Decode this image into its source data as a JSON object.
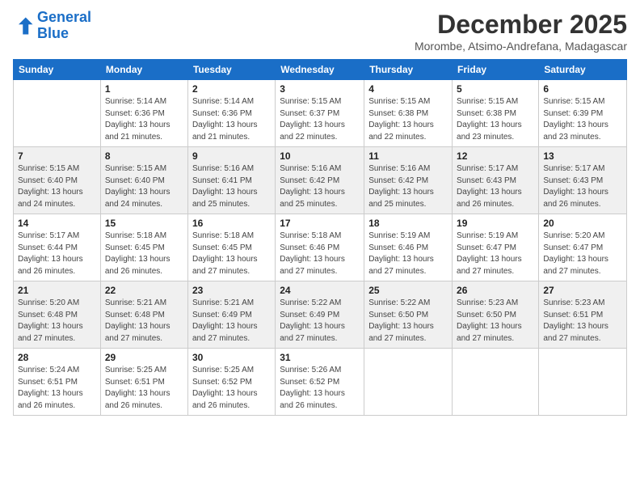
{
  "logo": {
    "line1": "General",
    "line2": "Blue"
  },
  "title": "December 2025",
  "location": "Morombe, Atsimo-Andrefana, Madagascar",
  "days_header": [
    "Sunday",
    "Monday",
    "Tuesday",
    "Wednesday",
    "Thursday",
    "Friday",
    "Saturday"
  ],
  "weeks": [
    [
      {
        "day": "",
        "info": ""
      },
      {
        "day": "1",
        "info": "Sunrise: 5:14 AM\nSunset: 6:36 PM\nDaylight: 13 hours\nand 21 minutes."
      },
      {
        "day": "2",
        "info": "Sunrise: 5:14 AM\nSunset: 6:36 PM\nDaylight: 13 hours\nand 21 minutes."
      },
      {
        "day": "3",
        "info": "Sunrise: 5:15 AM\nSunset: 6:37 PM\nDaylight: 13 hours\nand 22 minutes."
      },
      {
        "day": "4",
        "info": "Sunrise: 5:15 AM\nSunset: 6:38 PM\nDaylight: 13 hours\nand 22 minutes."
      },
      {
        "day": "5",
        "info": "Sunrise: 5:15 AM\nSunset: 6:38 PM\nDaylight: 13 hours\nand 23 minutes."
      },
      {
        "day": "6",
        "info": "Sunrise: 5:15 AM\nSunset: 6:39 PM\nDaylight: 13 hours\nand 23 minutes."
      }
    ],
    [
      {
        "day": "7",
        "info": "Sunrise: 5:15 AM\nSunset: 6:40 PM\nDaylight: 13 hours\nand 24 minutes."
      },
      {
        "day": "8",
        "info": "Sunrise: 5:15 AM\nSunset: 6:40 PM\nDaylight: 13 hours\nand 24 minutes."
      },
      {
        "day": "9",
        "info": "Sunrise: 5:16 AM\nSunset: 6:41 PM\nDaylight: 13 hours\nand 25 minutes."
      },
      {
        "day": "10",
        "info": "Sunrise: 5:16 AM\nSunset: 6:42 PM\nDaylight: 13 hours\nand 25 minutes."
      },
      {
        "day": "11",
        "info": "Sunrise: 5:16 AM\nSunset: 6:42 PM\nDaylight: 13 hours\nand 25 minutes."
      },
      {
        "day": "12",
        "info": "Sunrise: 5:17 AM\nSunset: 6:43 PM\nDaylight: 13 hours\nand 26 minutes."
      },
      {
        "day": "13",
        "info": "Sunrise: 5:17 AM\nSunset: 6:43 PM\nDaylight: 13 hours\nand 26 minutes."
      }
    ],
    [
      {
        "day": "14",
        "info": "Sunrise: 5:17 AM\nSunset: 6:44 PM\nDaylight: 13 hours\nand 26 minutes."
      },
      {
        "day": "15",
        "info": "Sunrise: 5:18 AM\nSunset: 6:45 PM\nDaylight: 13 hours\nand 26 minutes."
      },
      {
        "day": "16",
        "info": "Sunrise: 5:18 AM\nSunset: 6:45 PM\nDaylight: 13 hours\nand 27 minutes."
      },
      {
        "day": "17",
        "info": "Sunrise: 5:18 AM\nSunset: 6:46 PM\nDaylight: 13 hours\nand 27 minutes."
      },
      {
        "day": "18",
        "info": "Sunrise: 5:19 AM\nSunset: 6:46 PM\nDaylight: 13 hours\nand 27 minutes."
      },
      {
        "day": "19",
        "info": "Sunrise: 5:19 AM\nSunset: 6:47 PM\nDaylight: 13 hours\nand 27 minutes."
      },
      {
        "day": "20",
        "info": "Sunrise: 5:20 AM\nSunset: 6:47 PM\nDaylight: 13 hours\nand 27 minutes."
      }
    ],
    [
      {
        "day": "21",
        "info": "Sunrise: 5:20 AM\nSunset: 6:48 PM\nDaylight: 13 hours\nand 27 minutes."
      },
      {
        "day": "22",
        "info": "Sunrise: 5:21 AM\nSunset: 6:48 PM\nDaylight: 13 hours\nand 27 minutes."
      },
      {
        "day": "23",
        "info": "Sunrise: 5:21 AM\nSunset: 6:49 PM\nDaylight: 13 hours\nand 27 minutes."
      },
      {
        "day": "24",
        "info": "Sunrise: 5:22 AM\nSunset: 6:49 PM\nDaylight: 13 hours\nand 27 minutes."
      },
      {
        "day": "25",
        "info": "Sunrise: 5:22 AM\nSunset: 6:50 PM\nDaylight: 13 hours\nand 27 minutes."
      },
      {
        "day": "26",
        "info": "Sunrise: 5:23 AM\nSunset: 6:50 PM\nDaylight: 13 hours\nand 27 minutes."
      },
      {
        "day": "27",
        "info": "Sunrise: 5:23 AM\nSunset: 6:51 PM\nDaylight: 13 hours\nand 27 minutes."
      }
    ],
    [
      {
        "day": "28",
        "info": "Sunrise: 5:24 AM\nSunset: 6:51 PM\nDaylight: 13 hours\nand 26 minutes."
      },
      {
        "day": "29",
        "info": "Sunrise: 5:25 AM\nSunset: 6:51 PM\nDaylight: 13 hours\nand 26 minutes."
      },
      {
        "day": "30",
        "info": "Sunrise: 5:25 AM\nSunset: 6:52 PM\nDaylight: 13 hours\nand 26 minutes."
      },
      {
        "day": "31",
        "info": "Sunrise: 5:26 AM\nSunset: 6:52 PM\nDaylight: 13 hours\nand 26 minutes."
      },
      {
        "day": "",
        "info": ""
      },
      {
        "day": "",
        "info": ""
      },
      {
        "day": "",
        "info": ""
      }
    ]
  ]
}
